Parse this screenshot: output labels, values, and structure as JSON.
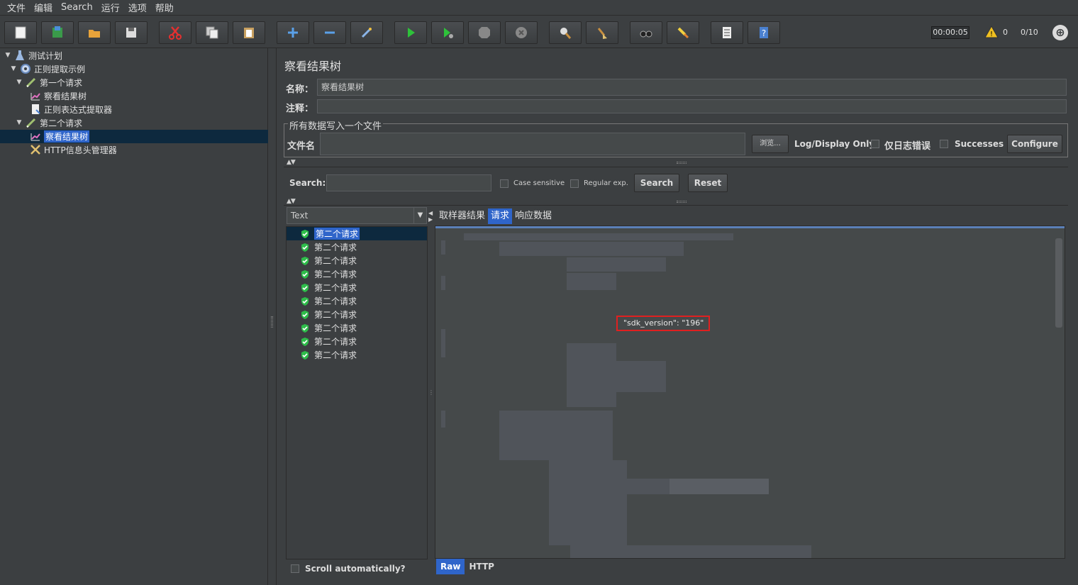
{
  "menu": [
    "文件",
    "编辑",
    "Search",
    "运行",
    "选项",
    "帮助"
  ],
  "toolbar": {
    "timer": "00:00:05",
    "warnings": "0",
    "threads": "0/10"
  },
  "tree": {
    "items": [
      {
        "label": "测试计划",
        "icon": "test-plan-icon"
      },
      {
        "label": "正则提取示例",
        "icon": "thread-group-gear-icon"
      },
      {
        "label": "第一个请求",
        "icon": "sampler-pen-icon"
      },
      {
        "label": "察看结果树",
        "icon": "listener-chart-icon"
      },
      {
        "label": "正则表达式提取器",
        "icon": "extractor-doc-icon"
      },
      {
        "label": "第二个请求",
        "icon": "sampler-pen-icon"
      },
      {
        "label": "察看结果树",
        "icon": "listener-chart-icon"
      },
      {
        "label": "HTTP信息头管理器",
        "icon": "config-tools-icon"
      }
    ]
  },
  "panel": {
    "title": "察看结果树",
    "name_label": "名称：",
    "name_value": "察看结果树",
    "comment_label": "注释：",
    "fieldset_legend": "所有数据写入一个文件",
    "file_label": "文件名",
    "browse_label": "浏览...",
    "log_display_label": "Log/Display Only:",
    "errors_only_label": "仅日志错误",
    "successes_label": "Successes",
    "configure_label": "Configure"
  },
  "search": {
    "label": "Search:",
    "case_sensitive": "Case sensitive",
    "regular_exp": "Regular exp.",
    "search_button": "Search",
    "reset_button": "Reset"
  },
  "renderer": {
    "selected": "Text"
  },
  "samples": [
    "第二个请求",
    "第二个请求",
    "第二个请求",
    "第二个请求",
    "第二个请求",
    "第二个请求",
    "第二个请求",
    "第二个请求",
    "第二个请求",
    "第二个请求"
  ],
  "tabs": [
    "取样器结果",
    "请求",
    "响应数据"
  ],
  "active_tab": "请求",
  "content": {
    "highlight": "\"sdk_version\": \"196\""
  },
  "bottom_tabs": [
    "Raw",
    "HTTP"
  ],
  "scroll_auto_label": "Scroll automatically?",
  "colors": {
    "background": "#3c3f41",
    "selection": "#2f65ca",
    "highlight_border": "#e02020"
  }
}
